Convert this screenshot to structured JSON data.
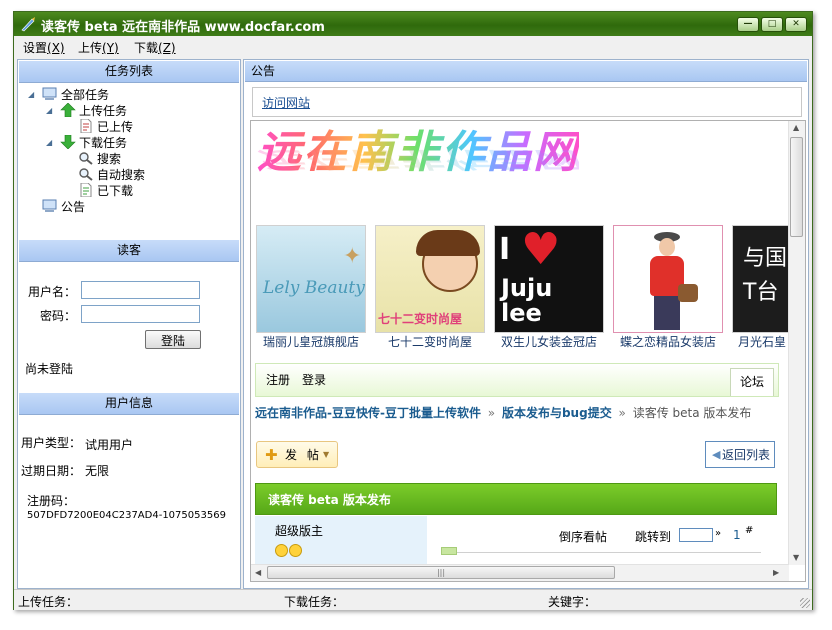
{
  "window": {
    "title": "读客传 beta   远在南非作品 www.docfar.com",
    "buttons": [
      "minimize",
      "maximize",
      "close"
    ]
  },
  "menu": [
    {
      "label": "设置",
      "key": "(X)"
    },
    {
      "label": "上传",
      "key": "(Y)"
    },
    {
      "label": "下载",
      "key": "(Z)"
    }
  ],
  "tasks": {
    "heading": "任务列表",
    "tree": [
      {
        "label": "全部任务",
        "icon": "computer-icon"
      },
      {
        "label": "上传任务",
        "icon": "upload-arrow-icon"
      },
      {
        "label": "已上传",
        "icon": "document-icon"
      },
      {
        "label": "下载任务",
        "icon": "download-arrow-icon"
      },
      {
        "label": "搜索",
        "icon": "magnifier-icon"
      },
      {
        "label": "自动搜索",
        "icon": "magnifier-icon"
      },
      {
        "label": "已下载",
        "icon": "document-icon"
      },
      {
        "label": "公告",
        "icon": "computer-icon"
      }
    ]
  },
  "reader": {
    "heading": "读客",
    "username_label": "用户名：",
    "username_value": "",
    "password_label": "密码：",
    "password_value": "",
    "login_button": "登陆",
    "status": "尚未登陆"
  },
  "userinfo": {
    "heading": "用户信息",
    "type_label": "用户类型：",
    "type_value": "试用用户",
    "expiry_label": "过期日期：",
    "expiry_value": "无限",
    "regcode_label": "注册码：",
    "regcode_value": "507DFD7200E04C237AD4-1075053569"
  },
  "notice": {
    "heading": "公告",
    "visit_link": "访问网站",
    "site_logo": "远在南非作品网",
    "shops": [
      {
        "caption": "瑞丽儿皇冠旗舰店",
        "image_text": "Lely Beauty"
      },
      {
        "caption": "七十二变时尚屋",
        "image_text": "七十二变时尚屋"
      },
      {
        "caption": "双生儿女装金冠店",
        "image_text": "I Juju lee"
      },
      {
        "caption": "蝶之恋精品女装店",
        "image_text": ""
      },
      {
        "caption": "月光石皇",
        "image_text": "与国 T台"
      }
    ],
    "forum": {
      "tab_register": "注册",
      "tab_login": "登录",
      "tab_forum": "论坛",
      "breadcrumb": [
        "远在南非作品-豆豆快传-豆丁批量上传软件",
        "版本发布与bug提交",
        "读客传 beta 版本发布"
      ],
      "breadcrumb_sep": "»",
      "post_button": "发 帖",
      "back_button": "返回列表",
      "thread_title": "读客传 beta 版本发布",
      "moderator": "超级版主",
      "reverse_order": "倒序看帖",
      "jump_to": "跳转到",
      "jump_arrow": "»",
      "floor": "1",
      "floor_mark": "#"
    }
  },
  "statusbar": {
    "upload": "上传任务：",
    "download": "下载任务：",
    "keyword": "关键字："
  },
  "colors": {
    "title_green": "#2f6a0c",
    "section_blue": "#b7d1f5",
    "forum_green": "#66b81e",
    "link_blue": "#1b5c8f"
  }
}
